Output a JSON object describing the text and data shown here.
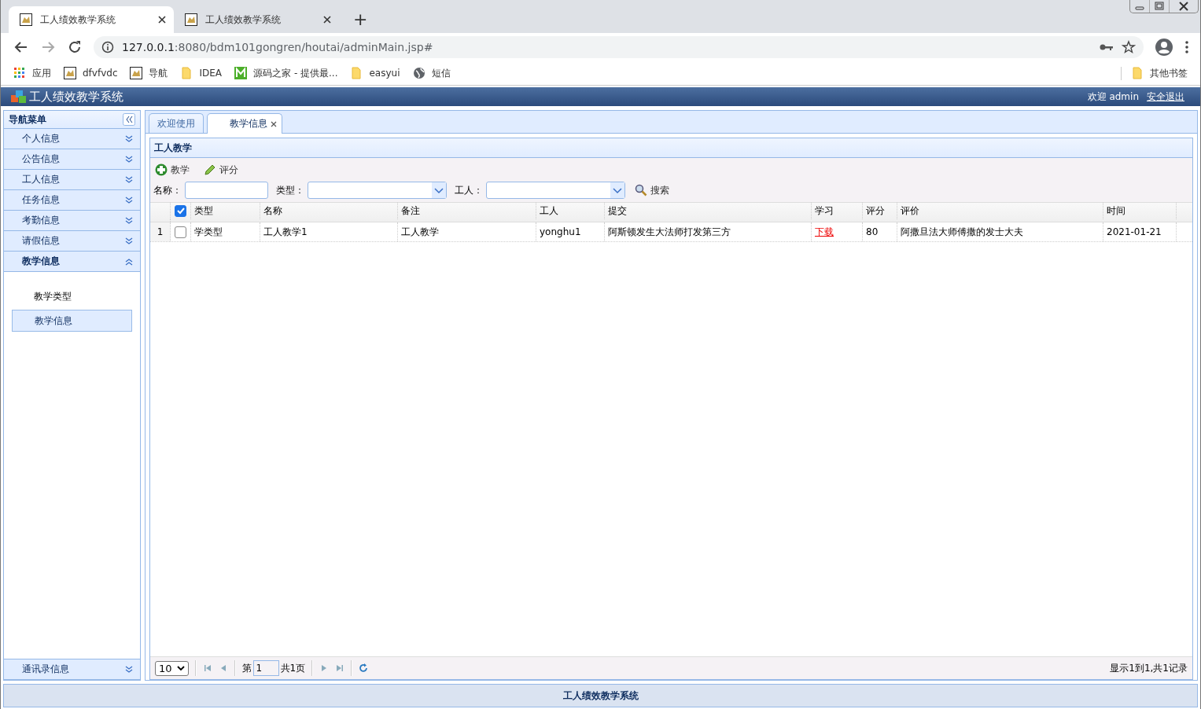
{
  "browser": {
    "tabs": [
      {
        "title": "工人绩效教学系统",
        "selected": true
      },
      {
        "title": "工人绩效教学系统",
        "selected": false
      }
    ],
    "new_tab": "+",
    "address": {
      "host": "127.0.0.1",
      "rest": ":8080/bdm101gongren/houtai/adminMain.jsp#"
    },
    "bookmarks": [
      {
        "label": "应用",
        "kind": "apps"
      },
      {
        "label": "dfvfvdc",
        "kind": "page"
      },
      {
        "label": "导航",
        "kind": "page"
      },
      {
        "label": "IDEA",
        "kind": "folder"
      },
      {
        "label": "源码之家 - 提供最...",
        "kind": "m"
      },
      {
        "label": "easyui",
        "kind": "folder"
      },
      {
        "label": "短信",
        "kind": "globe"
      }
    ],
    "other_bookmarks": "其他书签"
  },
  "app": {
    "title": "工人绩效教学系统",
    "welcome": "欢迎 admin",
    "logout": "安全退出"
  },
  "sidebar": {
    "title": "导航菜单",
    "sections": [
      {
        "label": "个人信息",
        "expanded": false
      },
      {
        "label": "公告信息",
        "expanded": false
      },
      {
        "label": "工人信息",
        "expanded": false
      },
      {
        "label": "任务信息",
        "expanded": false
      },
      {
        "label": "考勤信息",
        "expanded": false
      },
      {
        "label": "请假信息",
        "expanded": false
      },
      {
        "label": "教学信息",
        "expanded": true,
        "children": [
          {
            "label": "教学类型",
            "selected": false
          },
          {
            "label": "教学信息",
            "selected": true
          }
        ]
      },
      {
        "label": "通讯录信息",
        "expanded": false
      }
    ]
  },
  "content_tabs": [
    {
      "label": "欢迎使用",
      "selected": false,
      "closable": false
    },
    {
      "label": "教学信息",
      "selected": true,
      "closable": true
    }
  ],
  "panel": {
    "title": "工人教学",
    "toolbar": [
      {
        "label": "教学",
        "kind": "add"
      },
      {
        "label": "评分",
        "kind": "edit"
      }
    ],
    "filters": [
      {
        "label": "名称：",
        "kind": "text"
      },
      {
        "label": "类型：",
        "kind": "select"
      },
      {
        "label": "工人：",
        "kind": "select"
      }
    ],
    "search": "搜索",
    "table": {
      "header_checked": true,
      "columns": [
        {
          "label": "类型"
        },
        {
          "label": "名称"
        },
        {
          "label": "备注"
        },
        {
          "label": "工人"
        },
        {
          "label": "提交"
        },
        {
          "label": "学习",
          "kind": "link"
        },
        {
          "label": "评分"
        },
        {
          "label": "评价"
        },
        {
          "label": "时间"
        }
      ],
      "rows": [
        {
          "index": "1",
          "checked": false,
          "cells": [
            "学类型",
            "工人教学1",
            "工人教学",
            "yonghu1",
            "阿斯顿发生大法师打发第三方",
            "下载",
            "80",
            "阿撒旦法大师傅撒的发士大夫",
            "2021-01-21"
          ]
        }
      ]
    },
    "pager": {
      "page_size": "10",
      "page_prefix": "第",
      "page": "1",
      "total_pages": "共1页",
      "summary": "显示1到1,共1记录"
    }
  },
  "footer": "工人绩效教学系统"
}
